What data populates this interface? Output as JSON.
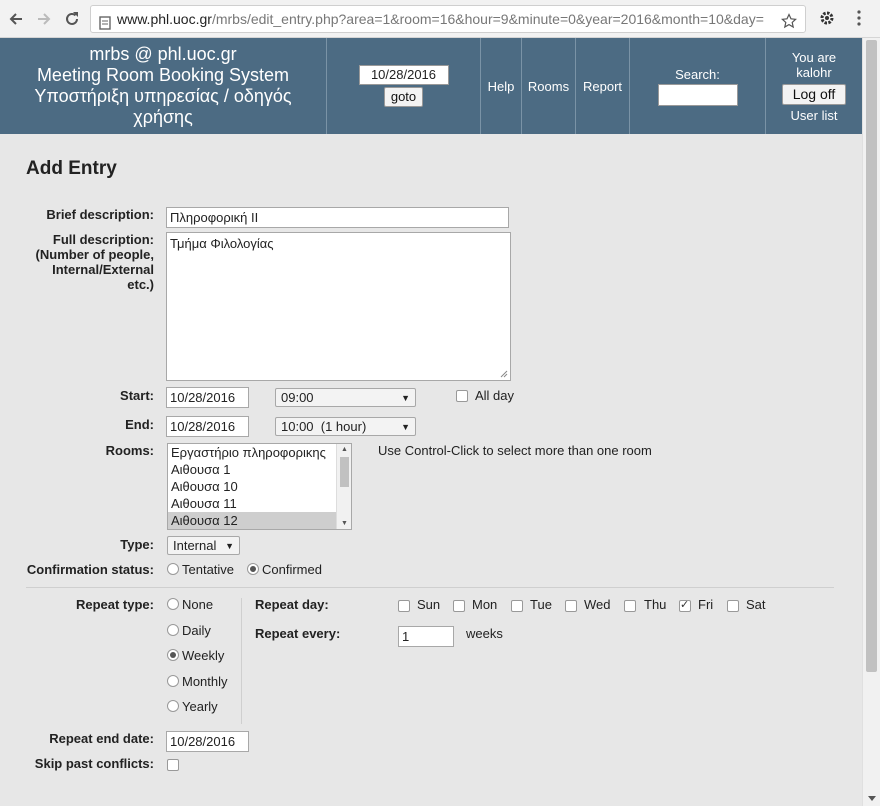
{
  "browser": {
    "url_host": "www.phl.uoc.gr",
    "url_path": "/mrbs/edit_entry.php?area=1&room=16&hour=9&minute=0&year=2016&month=10&day="
  },
  "header": {
    "site_title_line1": "mrbs @ phl.uoc.gr",
    "site_title_line2": "Meeting Room Booking System",
    "site_title_line3": "Υποστήριξη υπηρεσίας / οδηγός",
    "site_title_line4": "χρήσης",
    "goto_date": "10/28/2016",
    "goto_label": "goto",
    "nav_help": "Help",
    "nav_rooms": "Rooms",
    "nav_report": "Report",
    "search_label": "Search:",
    "search_value": "",
    "user_line1": "You are",
    "user_line2": "kalohr",
    "logoff_label": "Log off",
    "user_list_label": "User list",
    "bg_color": "#4c6b83"
  },
  "form": {
    "title": "Add Entry",
    "brief_label": "Brief description:",
    "brief_value": "Πληροφορική ΙΙ",
    "full_label_1": "Full description:",
    "full_label_2": "(Number of people,",
    "full_label_3": "Internal/External",
    "full_label_4": "etc.)",
    "full_value": "Τμήμα Φιλολογίας",
    "start_label": "Start:",
    "start_date": "10/28/2016",
    "start_time": "09:00",
    "all_day_label": "All day",
    "all_day_checked": false,
    "end_label": "End:",
    "end_date": "10/28/2016",
    "end_time": "10:00  (1 hour)",
    "rooms_label": "Rooms:",
    "rooms": [
      "Εργαστήριο πληροφορικης",
      "Αιθουσα 1",
      "Αιθουσα 10",
      "Αιθουσα 11",
      "Αιθουσα 12"
    ],
    "rooms_selected": "Αιθουσα 12",
    "rooms_hint": "Use Control-Click to select more than one room",
    "type_label": "Type:",
    "type_value": "Internal",
    "confirm_label": "Confirmation status:",
    "confirm_tentative": "Tentative",
    "confirm_confirmed": "Confirmed",
    "confirm_selected": "Confirmed",
    "repeat_type_label": "Repeat type:",
    "repeat_types": [
      "None",
      "Daily",
      "Weekly",
      "Monthly",
      "Yearly"
    ],
    "repeat_type_selected": "Weekly",
    "repeat_day_label": "Repeat day:",
    "days": [
      "Sun",
      "Mon",
      "Tue",
      "Wed",
      "Thu",
      "Fri",
      "Sat"
    ],
    "days_checked": [
      "Fri"
    ],
    "repeat_every_label": "Repeat every:",
    "repeat_every_value": "1",
    "repeat_every_unit": "weeks",
    "repeat_end_label": "Repeat end date:",
    "repeat_end_value": "10/28/2016",
    "skip_label": "Skip past conflicts:",
    "skip_checked": false
  }
}
